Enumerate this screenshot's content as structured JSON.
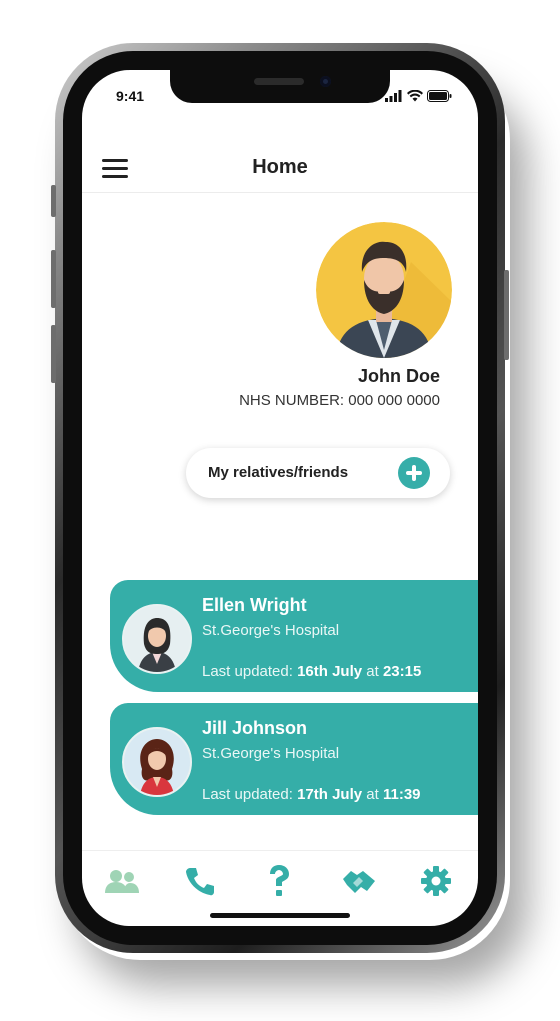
{
  "status_bar": {
    "time": "9:41"
  },
  "header": {
    "title": "Home"
  },
  "profile": {
    "name": "John Doe",
    "nhs_number": "NHS NUMBER: 000 000 0000"
  },
  "relatives_button": {
    "label": "My relatives/friends"
  },
  "cards": [
    {
      "name": "Ellen Wright",
      "hospital": "St.George's Hospital",
      "updated_prefix": "Last updated: ",
      "updated_date": "16th July",
      "updated_mid": " at ",
      "updated_time": "23:15"
    },
    {
      "name": "Jill Johnson",
      "hospital": "St.George's Hospital",
      "updated_prefix": "Last updated: ",
      "updated_date": "17th July",
      "updated_mid": " at ",
      "updated_time": "11:39"
    }
  ],
  "tabbar": {
    "items": [
      "people-icon",
      "phone-icon",
      "question-icon",
      "handshake-icon",
      "gear-icon"
    ],
    "active": "people-icon"
  },
  "colors": {
    "accent": "#35aea8",
    "tab_active": "#9fd4b5",
    "avatar_bg": "#f4c542"
  }
}
